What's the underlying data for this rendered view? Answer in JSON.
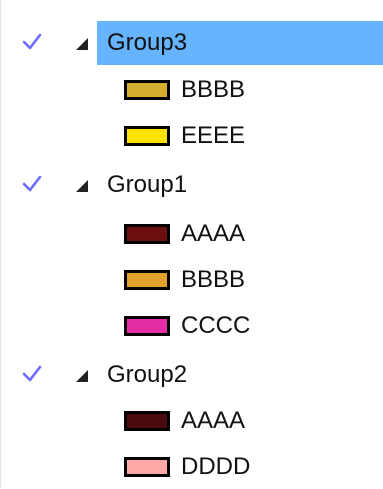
{
  "tree": {
    "groups": [
      {
        "label": "Group3",
        "checked": true,
        "expanded": true,
        "selected": true,
        "items": [
          {
            "label": "BBBB",
            "color": "#d5ad2f"
          },
          {
            "label": "EEEE",
            "color": "#ffe200"
          }
        ]
      },
      {
        "label": "Group1",
        "checked": true,
        "expanded": true,
        "selected": false,
        "items": [
          {
            "label": "AAAA",
            "color": "#6e0f0f"
          },
          {
            "label": "BBBB",
            "color": "#e0a32c"
          },
          {
            "label": "CCCC",
            "color": "#e32ea8"
          }
        ]
      },
      {
        "label": "Group2",
        "checked": true,
        "expanded": true,
        "selected": false,
        "items": [
          {
            "label": "AAAA",
            "color": "#4a0a0f"
          },
          {
            "label": "DDDD",
            "color": "#ffa8a8"
          }
        ]
      }
    ],
    "colors": {
      "selection": "#66b3ff",
      "check": "#6b6bff",
      "expander": "#222222"
    },
    "icons": {
      "check": "checkmark-icon",
      "expander": "expanded-triangle-icon"
    }
  }
}
